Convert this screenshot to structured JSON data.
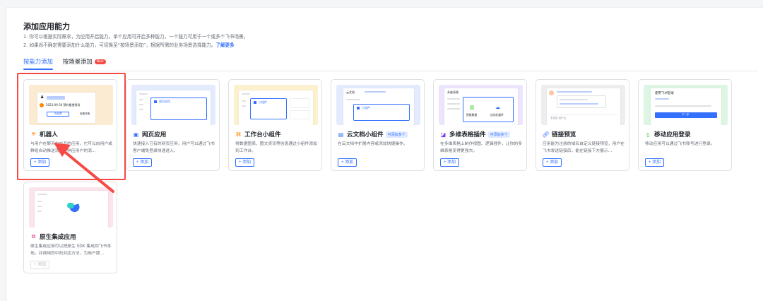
{
  "page": {
    "title": "添加应用能力",
    "desc1": "1. 你可以根据实际需求，为应用开启能力。单个应用可开启多种能力，一个能力可用于一个或多个飞书场景。",
    "desc2_prefix": "2. 如果尚不确定需要添加什么能力，可切换至“按场景添加”，根据所需的业务场景选择能力。",
    "learn_more": "了解更多"
  },
  "tabs": [
    {
      "label": "按能力添加",
      "active": true
    },
    {
      "label": "按场景添加",
      "badge": "New",
      "active": false
    }
  ],
  "add_label": "+ 添加",
  "cards": [
    {
      "name": "机器人",
      "icon": "robot-icon",
      "desc": "与用户在聊天中交互的应用，它可以向用户或群组自动推送消息，响应用户的消...",
      "disabled": false
    },
    {
      "name": "网页应用",
      "icon": "web-app-icon",
      "desc": "快速接入已有的网页应用，用户可以通过飞书客户端免登录快速进入。",
      "disabled": false
    },
    {
      "name": "工作台小组件",
      "icon": "widget-icon",
      "desc": "将数据图表、图文资讯等信息通过小组件添加到工作台。",
      "disabled": false
    },
    {
      "name": "云文档小组件",
      "icon": "doc-widget-icon",
      "tag": "可添加多个",
      "desc": "在云文档中扩展内容或添加快捷操作。",
      "disabled": false
    },
    {
      "name": "多维表格插件",
      "icon": "bitable-plugin-icon",
      "tag": "可添加多个",
      "desc": "在多维表格上制作视图、逻辑插件，让你的多维表格变得更强大。",
      "disabled": false
    },
    {
      "name": "链接预览",
      "icon": "link-icon",
      "desc": "应用能为注册的域名自定义链接预览，用户在飞书发送链接后，能在链接下方展示...",
      "disabled": false
    },
    {
      "name": "移动应用登录",
      "icon": "mobile-icon",
      "desc": "移动应用可以通过飞书账号进行登录。",
      "disabled": false
    },
    {
      "name": "原生集成应用",
      "icon": "native-app-icon",
      "desc": "原生集成应用可以把原生 SDK 集成到飞书本地，并调用其中的对应方法，为用户提...",
      "disabled": true
    }
  ],
  "previews": {
    "bot_line1": "2023-09-30 预约看望保母",
    "bot_button": "去处理",
    "bot_link": "查看详情",
    "web_label": "网页应用",
    "widget_label": "小组件",
    "doc_label": "云文档",
    "doc_sub": "小组件",
    "bitable_label": "多维表格",
    "bitable_item1": "智能数据",
    "bitable_item2": "自动化插件",
    "link_input": "发送给 用户名",
    "login_title": "使用飞书登录",
    "login_button": "下一步"
  },
  "colors": {
    "accent": "#3370ff",
    "highlight": "#f54a45"
  }
}
